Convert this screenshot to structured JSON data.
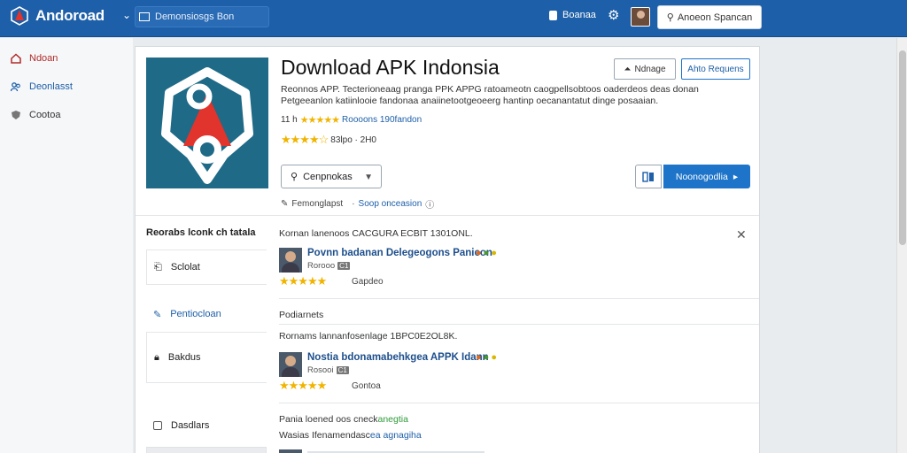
{
  "topbar": {
    "logo_text": "Andoroad",
    "search_placeholder": "Demonsiosgs Bon",
    "user_name": "Boanaa",
    "action_button": "Anoeon Spancan"
  },
  "leftnav": {
    "items": [
      {
        "label": "Ndoan",
        "icon": "home-icon"
      },
      {
        "label": "Deonlasst",
        "icon": "people-icon"
      },
      {
        "label": "Cootoa",
        "icon": "shield-icon"
      }
    ]
  },
  "app": {
    "title": "Download APK Indonsia",
    "btn_save": "Ndnage",
    "btn_report": "Ahto Requens",
    "description": "Reonnos APP. Tecterioneaag pranga PPK APPG ratoameotn caogpellsobtoos oaderdeos deas donan Petgeeanlon katiinlooie fandonaa anaiinetootgeoeerg hantinp oecanantatut dinge posaaian.",
    "meta1_prefix": "11 h",
    "meta1_link": "Roooons 190fandon",
    "meta2_text": "83lpo · 2H0",
    "dropdown_label": "Cenpnokas",
    "primary_label": "Noonogodlia",
    "crumb_text": "Femonglapst",
    "crumb_link": "Soop onceasion"
  },
  "subnav": {
    "title": "Reorabs lconk ch tatala",
    "items": [
      {
        "label": "Sclolat",
        "icon": "thumb-icon"
      },
      {
        "label": "Pentiocloan",
        "icon": "edit-icon"
      },
      {
        "label": "Bakdus",
        "icon": "lock-icon"
      },
      {
        "label": "Dasdlars",
        "icon": "checkbox-icon"
      }
    ]
  },
  "reviews": {
    "head1": "Kornan lanenoos CACGURA ECBIT 1301ONL.",
    "review1_name": "Povnn badanan Delegeogons Panicon",
    "review1_sub": "Rorooo",
    "review1_tag": "C1",
    "review1_count": "Gapdeo",
    "head2": "Podiarnets",
    "head3": "Rornams lannanfosenlage 1BPC0E2OL8K.",
    "review2_name": "Nostia bdonamabehkgea APPK Idann",
    "review2_sub": "Rosooi",
    "review2_tag": "C1",
    "review2_count": "Gontoa",
    "head4_a": "Pania loened oos cneck",
    "head4_b": "anegtia",
    "head5_a": "Wasias Ifenamendasc",
    "head5_b": "ea agnagiha"
  },
  "colors": {
    "topbar": "#1d5fa8",
    "primary": "#1d74c9",
    "star": "#f0b400",
    "app_icon_bg": "#1e6a87",
    "app_icon_red": "#e0342c"
  },
  "ratings": {
    "review1_stars": 5,
    "review2_stars": 5,
    "app_stars": 4.5
  }
}
